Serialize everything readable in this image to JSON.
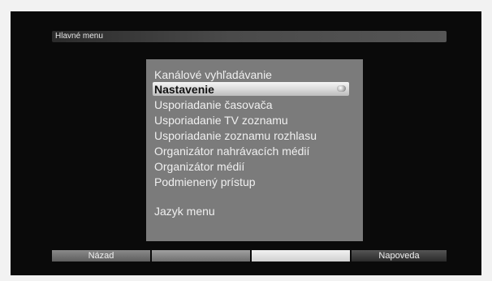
{
  "header": {
    "title": "Hlavné menu"
  },
  "menu": {
    "items": [
      {
        "label": "Kanálové vyhľadávanie",
        "selected": false
      },
      {
        "label": "Nastavenie",
        "selected": true
      },
      {
        "label": "Usporiadanie časovača",
        "selected": false
      },
      {
        "label": "Usporiadanie TV zoznamu",
        "selected": false
      },
      {
        "label": "Usporiadanie zoznamu rozhlasu",
        "selected": false
      },
      {
        "label": "Organizátor nahrávacích médií",
        "selected": false
      },
      {
        "label": "Organizátor médií",
        "selected": false
      },
      {
        "label": "Podmienený prístup",
        "selected": false
      },
      {
        "label": "Jazyk menu",
        "selected": false
      }
    ]
  },
  "footer": {
    "back_label": "Názad",
    "help_label": "Napoveda"
  }
}
